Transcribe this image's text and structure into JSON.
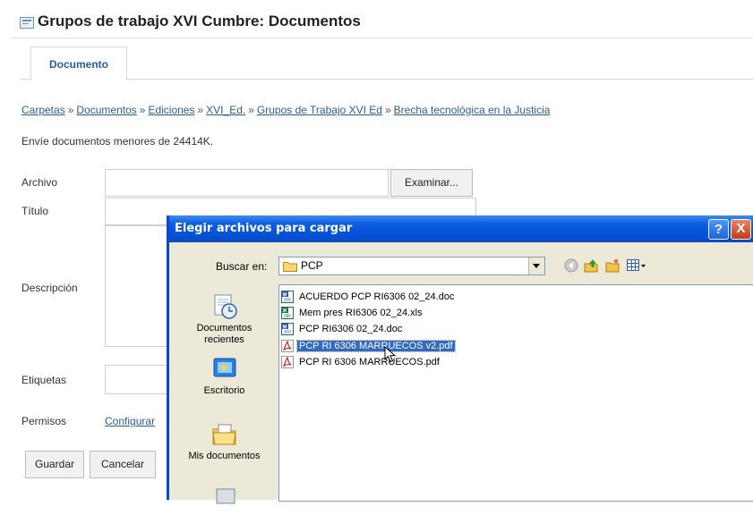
{
  "page": {
    "title": "Grupos de trabajo XVI Cumbre: Documentos",
    "tab": "Documento",
    "breadcrumb": [
      "Carpetas",
      "Documentos",
      "Ediciones",
      "XVI_Ed.",
      "Grupos de Trabajo XVI Ed",
      "Brecha tecnológica en la Justicia"
    ],
    "breadcrumb_sep": "»",
    "notice": "Envíe documentos menores de 24414K."
  },
  "form": {
    "archivo_label": "Archivo",
    "browse_button": "Examinar...",
    "titulo_label": "Título",
    "descripcion_label": "Descripción",
    "etiquetas_label": "Etiquetas",
    "permisos_label": "Permisos",
    "permisos_link": "Configurar",
    "save_button": "Guardar",
    "cancel_button": "Cancelar"
  },
  "dialog": {
    "title": "Elegir archivos para cargar",
    "help_button": "?",
    "close_button": "X",
    "lookin_label": "Buscar en:",
    "lookin_value": "PCP",
    "places": [
      {
        "label": "Documentos recientes",
        "icon": "recent-documents-icon"
      },
      {
        "label": "Escritorio",
        "icon": "desktop-icon"
      },
      {
        "label": "Mis documentos",
        "icon": "my-documents-icon"
      }
    ],
    "files": [
      {
        "name": "ACUERDO PCP RI6306 02_24.doc",
        "icon": "word-doc-icon"
      },
      {
        "name": "Mem pres RI6306 02_24.xls",
        "icon": "excel-xls-icon"
      },
      {
        "name": "PCP RI6306 02_24.doc",
        "icon": "word-doc-icon"
      },
      {
        "name": "PCP RI 6306 MARRUECOS v2.pdf",
        "icon": "pdf-icon",
        "selected": true
      },
      {
        "name": "PCP RI 6306 MARRUECOS.pdf",
        "icon": "pdf-icon"
      }
    ]
  },
  "colors": {
    "link": "#2a5d9c",
    "titlebar": "#0453d8",
    "selection": "#316ac5",
    "dialog_bg": "#ece9d8"
  }
}
